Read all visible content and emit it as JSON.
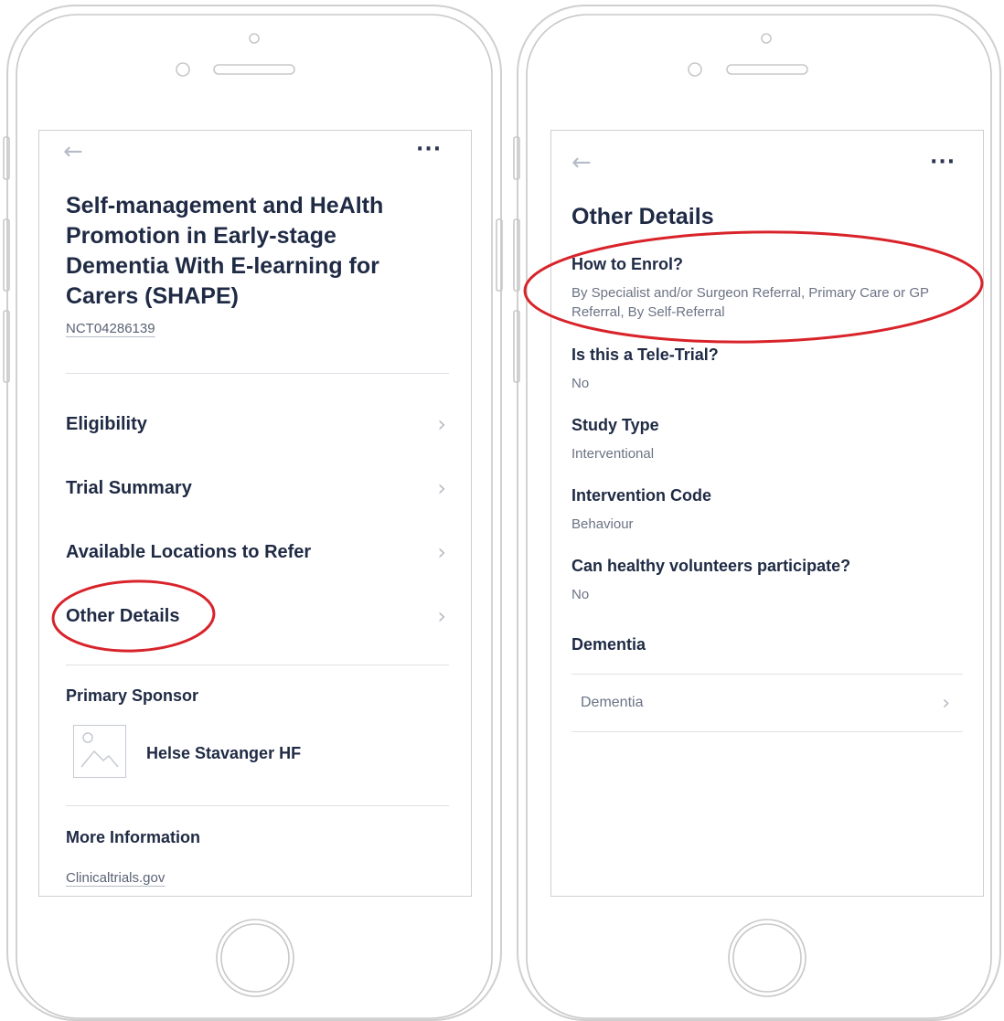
{
  "left_screen": {
    "back_icon": "arrow-left-icon",
    "more_icon": "more-horizontal-icon",
    "title": "Self-management and HeAlth Promotion in Early-stage Dementia With E-learning for Carers (SHAPE)",
    "trial_id": "NCT04286139",
    "menu_items": [
      {
        "label": "Eligibility"
      },
      {
        "label": "Trial Summary"
      },
      {
        "label": "Available Locations to Refer"
      },
      {
        "label": "Other Details"
      }
    ],
    "primary_sponsor": {
      "label": "Primary Sponsor",
      "name": "Helse Stavanger HF",
      "image_icon": "image-placeholder-icon"
    },
    "more_information": {
      "label": "More Information",
      "link": "Clinicaltrials.gov"
    }
  },
  "right_screen": {
    "back_icon": "arrow-left-icon",
    "more_icon": "more-horizontal-icon",
    "title": "Other Details",
    "fields": [
      {
        "label": "How to Enrol?",
        "value": "By Specialist and/or Surgeon Referral, Primary Care or GP Referral, By Self-Referral"
      },
      {
        "label": "Is this a Tele-Trial?",
        "value": "No"
      },
      {
        "label": "Study Type",
        "value": "Interventional"
      },
      {
        "label": "Intervention Code",
        "value": "Behaviour"
      },
      {
        "label": "Can healthy volunteers participate?",
        "value": "No"
      }
    ],
    "conditions": {
      "heading": "Dementia",
      "items": [
        {
          "label": "Dementia"
        }
      ]
    }
  },
  "colors": {
    "text_primary": "#1f2a44",
    "text_secondary": "#6b7384",
    "highlight_ring": "#d8232a",
    "device_outline": "#cfcfcf"
  }
}
